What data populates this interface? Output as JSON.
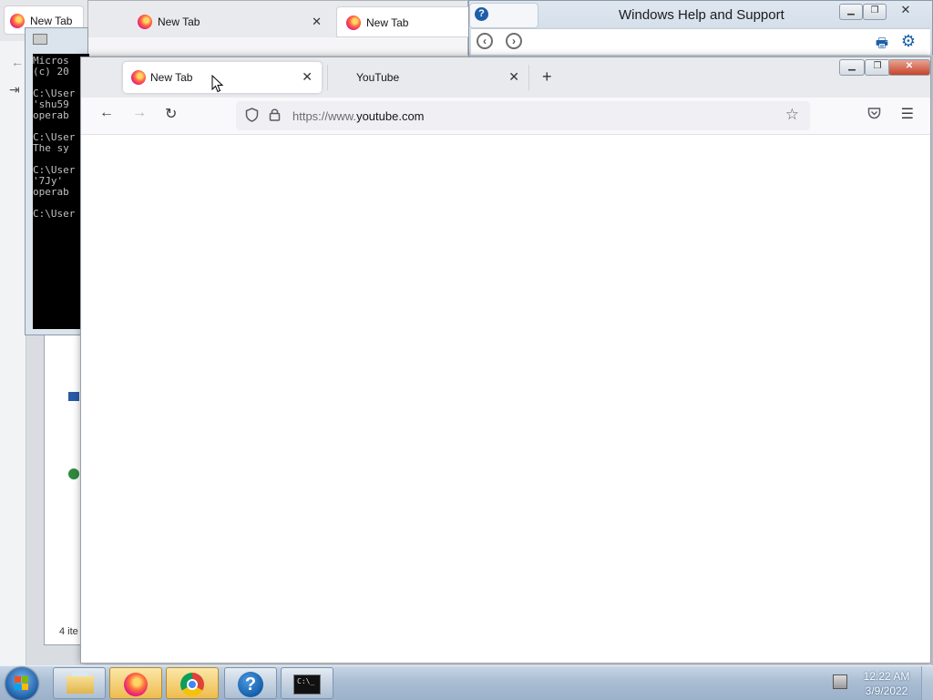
{
  "bg_window_left": {
    "tab_title": "New Tab"
  },
  "bg_window_2": {
    "tabs": [
      {
        "title": "New Tab"
      },
      {
        "title": "New Tab"
      }
    ]
  },
  "help_window": {
    "title": "Windows Help and Support",
    "back_icon": "circle-arrow-left",
    "forward_icon": "circle-arrow-right",
    "print_icon": "printer",
    "settings_icon": "gear"
  },
  "cmd_window": {
    "lines": [
      "Micros",
      "(c) 20",
      "",
      "C:\\User",
      "'shu59",
      "operab",
      "",
      "C:\\User",
      "The sy",
      "",
      "C:\\User",
      "'7Jy' ",
      "operab",
      "",
      "C:\\User"
    ]
  },
  "explorer_window": {
    "status_text": "4 ite"
  },
  "main_browser": {
    "tabs": [
      {
        "title": "New Tab",
        "active": true,
        "icon": "firefox-logo"
      },
      {
        "title": "YouTube",
        "active": false,
        "icon": "none"
      }
    ],
    "new_tab_symbol": "+",
    "tab_close_symbol": "✕",
    "url_scheme": "https://www.",
    "url_host": "youtube.com",
    "window_controls": {
      "minimize": "▁",
      "maximize": "❐",
      "close": "✕"
    },
    "nav_icons": {
      "back": "←",
      "forward": "→",
      "reload": "↻",
      "shield": "🛡",
      "lock": "🔒",
      "star": "☆",
      "pocket": "◡",
      "menu": "☰"
    }
  },
  "taskbar": {
    "items": [
      {
        "name": "windows-explorer",
        "highlighted": false
      },
      {
        "name": "firefox",
        "highlighted": true
      },
      {
        "name": "chrome",
        "highlighted": true
      },
      {
        "name": "help-and-support",
        "highlighted": false
      },
      {
        "name": "command-prompt",
        "highlighted": false
      }
    ],
    "cmd_icon_text": "C:\\_",
    "help_icon_text": "?",
    "clock_time": "12:22 AM",
    "clock_date": "3/9/2022"
  }
}
